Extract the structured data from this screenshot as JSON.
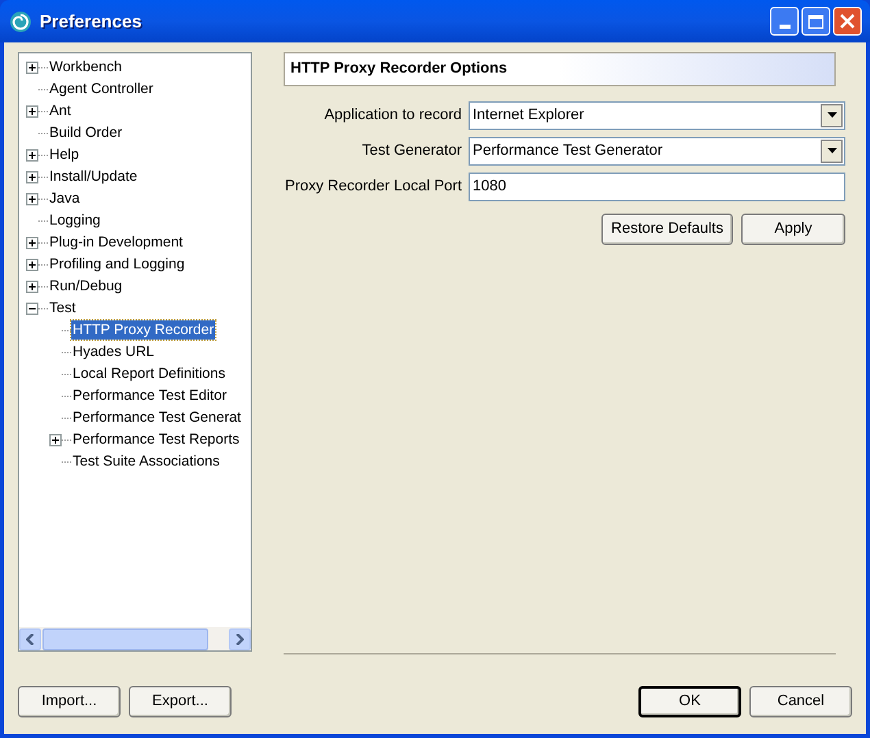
{
  "window": {
    "title": "Preferences"
  },
  "tree": [
    {
      "label": "Workbench",
      "kind": "folder",
      "expanded": false,
      "selected": false
    },
    {
      "label": "Agent Controller",
      "kind": "leaf",
      "selected": false
    },
    {
      "label": "Ant",
      "kind": "folder",
      "expanded": false,
      "selected": false
    },
    {
      "label": "Build Order",
      "kind": "leaf",
      "selected": false
    },
    {
      "label": "Help",
      "kind": "folder",
      "expanded": false,
      "selected": false
    },
    {
      "label": "Install/Update",
      "kind": "folder",
      "expanded": false,
      "selected": false
    },
    {
      "label": "Java",
      "kind": "folder",
      "expanded": false,
      "selected": false
    },
    {
      "label": "Logging",
      "kind": "leaf",
      "selected": false
    },
    {
      "label": "Plug-in Development",
      "kind": "folder",
      "expanded": false,
      "selected": false
    },
    {
      "label": "Profiling and Logging",
      "kind": "folder",
      "expanded": false,
      "selected": false
    },
    {
      "label": "Run/Debug",
      "kind": "folder",
      "expanded": false,
      "selected": false
    },
    {
      "label": "Test",
      "kind": "folder",
      "expanded": true,
      "selected": false,
      "children": [
        {
          "label": "HTTP Proxy Recorder",
          "kind": "leaf",
          "selected": true
        },
        {
          "label": "Hyades URL",
          "kind": "leaf",
          "selected": false
        },
        {
          "label": "Local Report Definitions",
          "kind": "leaf",
          "selected": false
        },
        {
          "label": "Performance Test Editor",
          "kind": "leaf",
          "selected": false
        },
        {
          "label": "Performance Test Generat",
          "kind": "leaf",
          "selected": false
        },
        {
          "label": "Performance Test Reports",
          "kind": "folder",
          "expanded": false,
          "selected": false
        },
        {
          "label": "Test Suite Associations",
          "kind": "leaf",
          "selected": false
        }
      ]
    }
  ],
  "page": {
    "title": "HTTP Proxy Recorder Options",
    "fields": [
      {
        "label": "Application to record",
        "kind": "dropdown",
        "value": "Internet Explorer"
      },
      {
        "label": "Test Generator",
        "kind": "dropdown",
        "value": "Performance Test Generator"
      },
      {
        "label": "Proxy Recorder Local Port",
        "kind": "text",
        "value": "1080"
      }
    ],
    "buttons": [
      "Restore Defaults",
      "Apply"
    ]
  },
  "footer": {
    "left_buttons": [
      "Import...",
      "Export..."
    ],
    "right_buttons": [
      {
        "label": "OK",
        "default": true
      },
      {
        "label": "Cancel",
        "default": false
      }
    ]
  }
}
